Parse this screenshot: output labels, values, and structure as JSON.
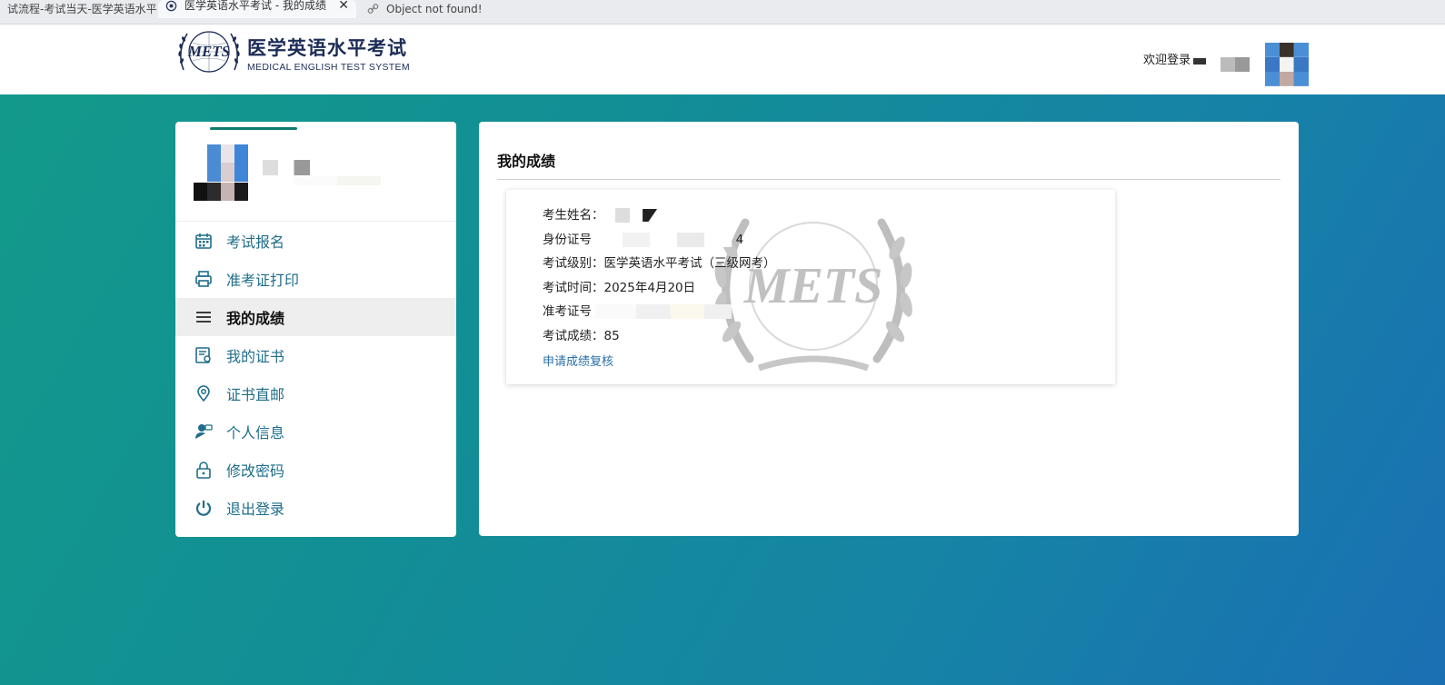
{
  "browser": {
    "tabs": [
      {
        "title": "试流程-考试当天-医学英语水平",
        "active": false
      },
      {
        "title": "医学英语水平考试 - 我的成绩",
        "active": true
      },
      {
        "title": "Object not found!",
        "active": false
      }
    ],
    "close_glyph": "✕"
  },
  "header": {
    "logo_emblem_text": "METS",
    "logo_cn": "医学英语水平考试",
    "logo_en": "MEDICAL ENGLISH TEST SYSTEM",
    "welcome": "欢迎登录"
  },
  "sidebar": {
    "items": [
      {
        "label": "考试报名",
        "icon": "calendar-icon",
        "active": false
      },
      {
        "label": "准考证打印",
        "icon": "printer-icon",
        "active": false
      },
      {
        "label": "我的成绩",
        "icon": "menu-lines-icon",
        "active": true
      },
      {
        "label": "我的证书",
        "icon": "certificate-icon",
        "active": false
      },
      {
        "label": "证书直邮",
        "icon": "location-pin-icon",
        "active": false
      },
      {
        "label": "个人信息",
        "icon": "user-icon",
        "active": false
      },
      {
        "label": "修改密码",
        "icon": "lock-icon",
        "active": false
      },
      {
        "label": "退出登录",
        "icon": "power-icon",
        "active": false
      }
    ]
  },
  "main": {
    "title": "我的成绩",
    "score": {
      "name_label": "考生姓名：",
      "id_label": "身份证号",
      "id_visible_tail": "4",
      "level_label": "考试级别：",
      "level_value": "医学英语水平考试（三级网考）",
      "date_label": "考试时间：",
      "date_value": "2025年4月20日",
      "ticket_label": "准考证号",
      "score_label": "考试成绩：",
      "score_value": "85",
      "recheck_link": "申请成绩复核"
    },
    "watermark_text": "METS"
  },
  "colors": {
    "accent": "#1f6d8a",
    "link": "#2a6fa8",
    "logo_navy": "#1c2c56",
    "bg_gradient_start": "#139a8a",
    "bg_gradient_end": "#1a6fb3"
  }
}
